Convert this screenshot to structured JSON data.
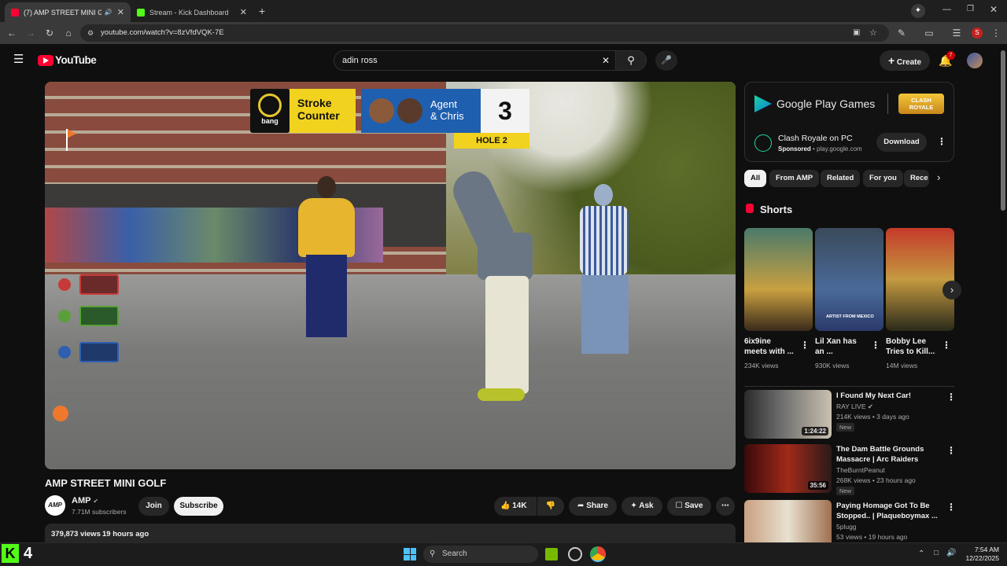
{
  "browser": {
    "tabs": [
      {
        "title": "(7) AMP STREET MINI GOLF",
        "active": true
      },
      {
        "title": "Stream - Kick Dashboard",
        "active": false
      }
    ],
    "url": "youtube.com/watch?v=8zVfdVQK-7E",
    "profile_initial": "S"
  },
  "youtube": {
    "logo_text": "YouTube",
    "search_value": "adin ross",
    "create_label": "Create",
    "notification_count": "7"
  },
  "video": {
    "title": "AMP STREET MINI GOLF",
    "channel": "AMP",
    "subscribers": "7.71M subscribers",
    "join_label": "Join",
    "subscribe_label": "Subscribe",
    "likes": "14K",
    "share_label": "Share",
    "ask_label": "Ask",
    "save_label": "Save",
    "views": "379,873 views",
    "posted": "19 hours ago",
    "overlay": {
      "brand": "bang",
      "counter_label_1": "Stroke",
      "counter_label_2": "Counter",
      "player_1": "Agent",
      "player_2": "& Chris",
      "score": "3",
      "hole": "HOLE 2"
    }
  },
  "ad": {
    "brand": "Google Play Games",
    "game_logo": "CLASH ROYALE",
    "title": "Clash Royale on PC",
    "sponsored": "Sponsored",
    "domain": "play.google.com",
    "cta": "Download"
  },
  "filters": [
    "All",
    "From AMP",
    "Related",
    "For you",
    "Rece"
  ],
  "shorts": {
    "heading": "Shorts",
    "items": [
      {
        "title_1": "6ix9ine",
        "title_2": "meets with ...",
        "views": "234K views"
      },
      {
        "title_1": "Lil Xan has",
        "title_2": "an ...",
        "views": "930K views",
        "thumb_text": "ARTIST FROM MEXICO"
      },
      {
        "title_1": "Bobby Lee",
        "title_2": "Tries to Kill...",
        "views": "14M views"
      }
    ]
  },
  "recommended": [
    {
      "title_1": "I Found My Next Car!",
      "title_2": "",
      "channel": "RAY LIVE",
      "meta": "214K views • 3 days ago",
      "badge": "New",
      "duration": "1:24:22"
    },
    {
      "title_1": "The Dam Battle Grounds",
      "title_2": "Massacre | Arc Raiders",
      "channel": "TheBurntPeanut",
      "meta": "268K views • 23 hours ago",
      "badge": "New",
      "duration": "35:56"
    },
    {
      "title_1": "Paying Homage Got To Be",
      "title_2": "Stopped.. | Plaqueboymax ...",
      "channel": "5plugg",
      "meta": "53 views • 19 hours ago",
      "badge": "",
      "duration": ""
    }
  ],
  "taskbar": {
    "kick_count": "4",
    "search_label": "Search",
    "time": "7:54 AM",
    "date": "12/22/2025"
  }
}
